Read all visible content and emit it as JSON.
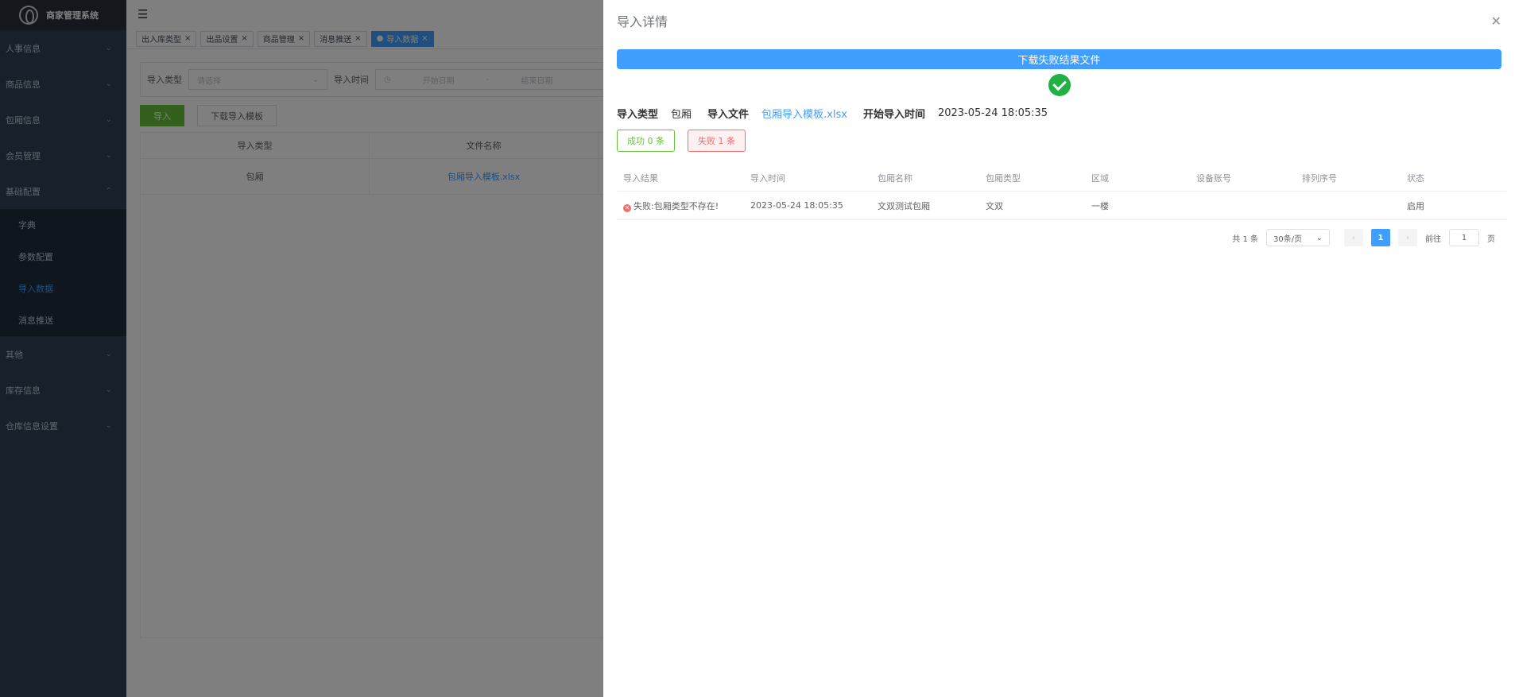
{
  "app": {
    "title": "商家管理系统"
  },
  "sidebar": {
    "items": [
      {
        "label": "人事信息"
      },
      {
        "label": "商品信息"
      },
      {
        "label": "包厢信息"
      },
      {
        "label": "会员管理"
      },
      {
        "label": "基础配置",
        "expanded": true
      }
    ],
    "subitems": [
      {
        "label": "字典"
      },
      {
        "label": "参数配置"
      },
      {
        "label": "导入数据",
        "active": true
      },
      {
        "label": "消息推送"
      }
    ],
    "bottom_items": [
      {
        "label": "其他"
      },
      {
        "label": "库存信息"
      },
      {
        "label": "仓库信息设置"
      }
    ]
  },
  "tags": [
    {
      "label": "出入库类型"
    },
    {
      "label": "出品设置"
    },
    {
      "label": "商品管理"
    },
    {
      "label": "消息推送"
    },
    {
      "label": "导入数据",
      "active": true
    }
  ],
  "search": {
    "type_label": "导入类型",
    "type_placeholder": "请选择",
    "time_label": "导入时间",
    "start_placeholder": "开始日期",
    "separator": "-",
    "end_placeholder": "结束日期"
  },
  "toolbar": {
    "import_label": "导入",
    "download_template_label": "下载导入模板"
  },
  "bg_table": {
    "headers": [
      "导入类型",
      "文件名称"
    ],
    "rows": [
      [
        "包厢",
        "包厢导入模板.xlsx"
      ]
    ]
  },
  "drawer": {
    "title": "导入详情",
    "download_label": "下载失败结果文件",
    "info": {
      "type_label": "导入类型",
      "type_value": "包厢",
      "file_label": "导入文件",
      "file_value": "包厢导入模板.xlsx",
      "time_label": "开始导入时间",
      "time_value": "2023-05-24 18:05:35"
    },
    "success_tag": "成功 0 条",
    "fail_tag": "失败 1 条",
    "table": {
      "headers": [
        "导入结果",
        "导入时间",
        "包厢名称",
        "包厢类型",
        "区域",
        "设备账号",
        "排列序号",
        "状态"
      ],
      "rows": [
        {
          "result": "失败:包厢类型不存在!",
          "time": "2023-05-24 18:05:35",
          "name": "文双测试包厢",
          "type": "文双",
          "area": "一楼",
          "device": "",
          "order": "",
          "status": "启用"
        }
      ]
    },
    "pagination": {
      "total": "共 1 条",
      "page_size": "30条/页",
      "current_page": "1",
      "goto_prefix": "前往",
      "goto_value": "1",
      "goto_suffix": "页"
    }
  }
}
